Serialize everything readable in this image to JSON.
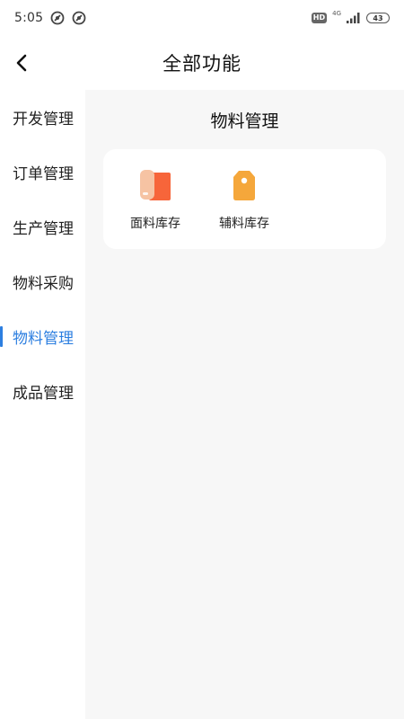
{
  "status_bar": {
    "time": "5:05",
    "hd": "HD",
    "network": "4G",
    "battery": "43"
  },
  "header": {
    "title": "全部功能"
  },
  "sidebar": {
    "items": [
      {
        "label": "开发管理",
        "active": false
      },
      {
        "label": "订单管理",
        "active": false
      },
      {
        "label": "生产管理",
        "active": false
      },
      {
        "label": "物料采购",
        "active": false
      },
      {
        "label": "物料管理",
        "active": true
      },
      {
        "label": "成品管理",
        "active": false
      }
    ]
  },
  "main": {
    "section_title": "物料管理",
    "functions": [
      {
        "label": "面料库存",
        "icon": "fabric-roll-icon"
      },
      {
        "label": "辅料库存",
        "icon": "tag-icon"
      }
    ]
  },
  "colors": {
    "accent": "#2d7fe0",
    "panel_bg": "#f7f7f7",
    "fabric_light": "#f6c3a3",
    "fabric_dark": "#f7653a",
    "tag_color": "#f5a73b"
  }
}
